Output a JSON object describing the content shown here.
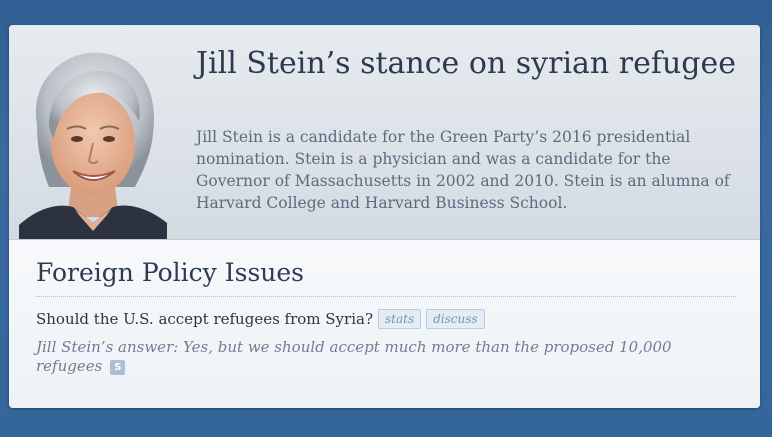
{
  "candidate": {
    "title": "Jill Stein’s stance on syrian refugee",
    "description": "Jill Stein is a candidate for the Green Party’s 2016 presidential nomination. Stein is a physician and was a candidate for the Governor of Massachusetts in 2002 and 2010. Stein is an alumna of Harvard College and Harvard Business School.",
    "portrait_icon": "person-portrait"
  },
  "section": {
    "title": "Foreign Policy Issues"
  },
  "issue": {
    "question": "Should the U.S. accept refugees from Syria?",
    "stats_label": "stats",
    "discuss_label": "discuss",
    "answer": "Jill Stein’s answer: Yes, but we should accept much more than the proposed 10,000 refugees",
    "source_badge": "S"
  },
  "colors": {
    "background": "#35669b",
    "title_text": "#2c3a4f",
    "answer_text": "#6f7e91",
    "tag_border": "#b9cde0"
  }
}
